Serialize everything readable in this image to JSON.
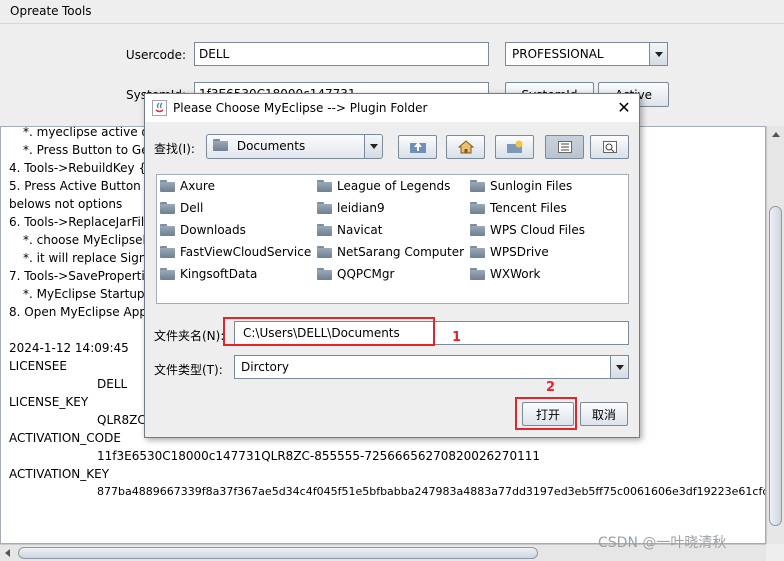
{
  "menu": {
    "items": [
      "Opreate",
      "Tools"
    ]
  },
  "form": {
    "usercode_label": "Usercode:",
    "usercode_value": "DELL",
    "edition_value": "PROFESSIONAL",
    "systemid_label": "SystemId:",
    "systemid_value": "1f3E6530C18000c147731",
    "systemid_button": "SystemId",
    "active_button": "Active"
  },
  "log": {
    "lines": [
      "*. myeclipse active dialog",
      "*. Press Button to Gen",
      "4. Tools->RebuildKey {C",
      "5. Press Active Button",
      "belows not options",
      "6. Tools->ReplaceJarFile",
      "*. choose MyEclipseFo",
      "*. it will replace Signatu",
      "7. Tools->SavePropertites",
      "*. MyEclipse Startup W",
      "8. Open MyEclipse Applic",
      "",
      "2024-1-12 14:09:45",
      "LICENSEE",
      "DELL",
      "LICENSE_KEY",
      "QLR8ZC",
      "ACTIVATION_CODE",
      "11f3E6530C18000c147731QLR8ZC-855555-72566656270820026270111",
      "ACTIVATION_KEY",
      "877ba4889667339f8a37f367ae5d34c4f045f51e5bfbabba247983a4883a77dd3197ed3eb5ff75c0061606e3df19223e61cfc"
    ]
  },
  "dialog": {
    "title": "Please Choose MyEclipse --> Plugin Folder",
    "look_in_label": "查找(I):",
    "look_in_value": "Documents",
    "files": [
      [
        "Axure",
        "League of Legends",
        "Sunlogin Files"
      ],
      [
        "Dell",
        "leidian9",
        "Tencent Files"
      ],
      [
        "Downloads",
        "Navicat",
        "WPS Cloud Files"
      ],
      [
        "FastViewCloudService",
        "NetSarang Computer",
        "WPSDrive"
      ],
      [
        "KingsoftData",
        "QQPCMgr",
        "WXWork"
      ]
    ],
    "folder_name_label": "文件夹名(N):",
    "folder_name_value": "C:\\Users\\DELL\\Documents",
    "file_type_label": "文件类型(T):",
    "file_type_value": "Dirctory",
    "open_button": "打开",
    "cancel_button": "取消"
  },
  "annotations": {
    "step1": "1",
    "step2": "2"
  },
  "watermark": "CSDN @一叶晓清秋",
  "colors": {
    "annotation_red": "#e3242b",
    "window_bg": "#eeeeee"
  }
}
